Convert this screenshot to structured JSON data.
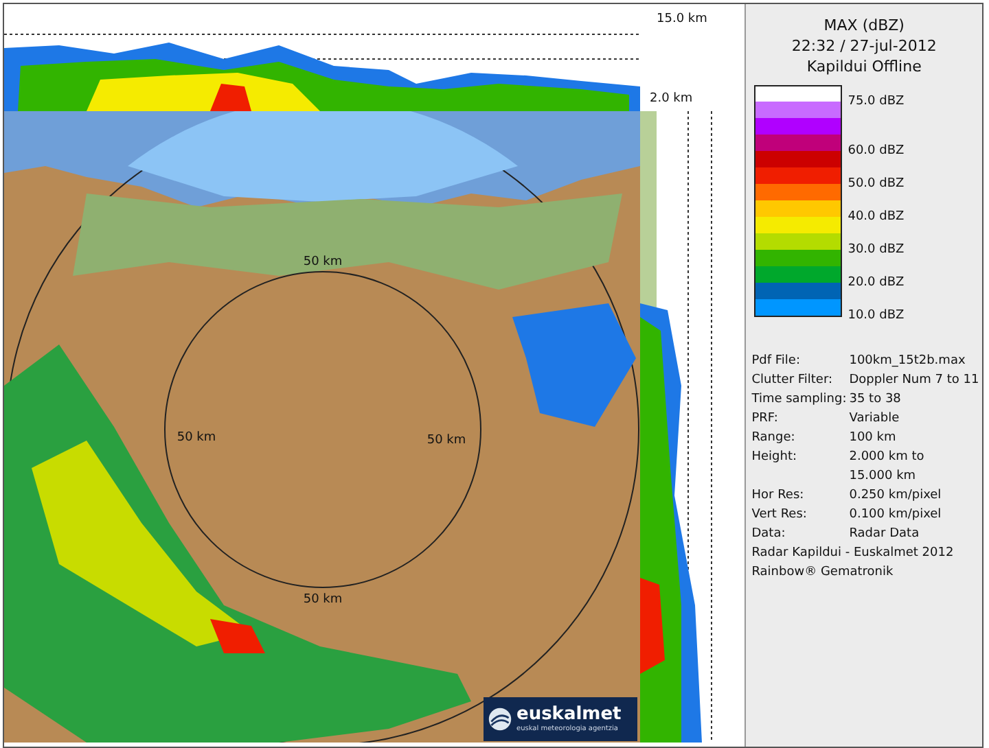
{
  "top_section": {
    "top_label": "15.0 km",
    "bottom_label": "2.0 km"
  },
  "map": {
    "ring_labels": [
      "50 km",
      "50 km",
      "50 km",
      "50 km"
    ],
    "logo": {
      "name": "euskalmet",
      "subtitle": "euskal meteorologia agentzia"
    }
  },
  "panel": {
    "title": "MAX (dBZ)",
    "datetime": "22:32 / 27-jul-2012",
    "status": "Kapildui Offline",
    "legend": [
      {
        "color": "#ffffff",
        "label": "75.0 dBZ"
      },
      {
        "color": "#c86bff"
      },
      {
        "color": "#b000ff"
      },
      {
        "color": "#c0007a",
        "label": "60.0 dBZ"
      },
      {
        "color": "#cc0000"
      },
      {
        "color": "#f01e00",
        "label": "50.0 dBZ"
      },
      {
        "color": "#ff6a00"
      },
      {
        "color": "#ffc800",
        "label": "40.0 dBZ"
      },
      {
        "color": "#f5eb00"
      },
      {
        "color": "#b4dc00",
        "label": "30.0 dBZ"
      },
      {
        "color": "#32b400"
      },
      {
        "color": "#00a82c",
        "label": "20.0 dBZ"
      },
      {
        "color": "#0064b4"
      },
      {
        "color": "#0096ff",
        "label": "10.0 dBZ"
      }
    ],
    "info": [
      {
        "label": "Pdf File:",
        "value": "100km_15t2b.max"
      },
      {
        "label": "Clutter Filter:",
        "value": "Doppler Num 7 to 11"
      },
      {
        "label": "Time sampling:",
        "value": "35 to 38"
      },
      {
        "label": "PRF:",
        "value": "Variable"
      },
      {
        "label": "Range:",
        "value": "100 km"
      },
      {
        "label": "Height:",
        "value": "2.000 km to"
      },
      {
        "value": "15.000 km"
      },
      {
        "label": "Hor Res:",
        "value": "0.250 km/pixel"
      },
      {
        "label": "Vert Res:",
        "value": "0.100 km/pixel"
      },
      {
        "label": "Data:",
        "value": "Radar Data"
      }
    ],
    "notes": [
      "Radar Kapildui - Euskalmet 2012",
      "Rainbow® Gematronik"
    ]
  }
}
